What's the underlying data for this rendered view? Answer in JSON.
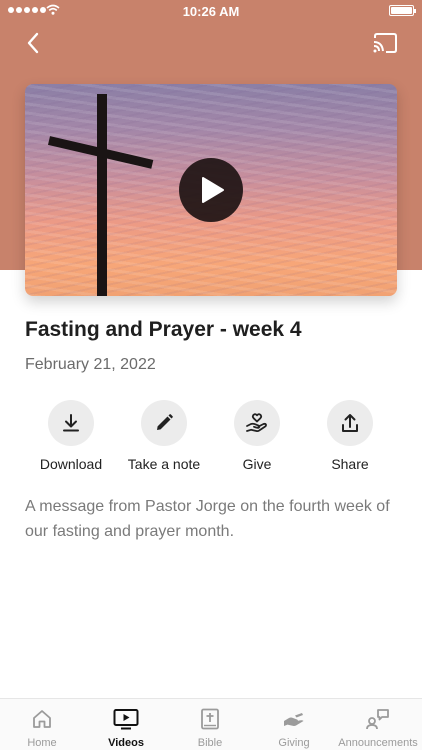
{
  "status_bar": {
    "time": "10:26 AM"
  },
  "header": {
    "back_icon": "chevron-left-icon",
    "cast_icon": "cast-icon"
  },
  "video": {
    "play_icon": "play-icon"
  },
  "sermon": {
    "title": "Fasting and Prayer - week 4",
    "date": "February 21, 2022",
    "description": "A message from Pastor Jorge on the fourth week of our fasting and prayer month."
  },
  "actions": [
    {
      "label": "Download",
      "icon": "download-icon"
    },
    {
      "label": "Take a note",
      "icon": "pencil-icon"
    },
    {
      "label": "Give",
      "icon": "hand-heart-icon"
    },
    {
      "label": "Share",
      "icon": "share-icon"
    }
  ],
  "tabs": [
    {
      "label": "Home",
      "icon": "home-icon",
      "active": false
    },
    {
      "label": "Videos",
      "icon": "video-icon",
      "active": true
    },
    {
      "label": "Bible",
      "icon": "bible-icon",
      "active": false
    },
    {
      "label": "Giving",
      "icon": "giving-icon",
      "active": false
    },
    {
      "label": "Announcements",
      "icon": "announcements-icon",
      "active": false
    }
  ],
  "colors": {
    "header": "#c8826b",
    "active_tab": "#111111",
    "inactive_tab": "#9b9b9b"
  }
}
